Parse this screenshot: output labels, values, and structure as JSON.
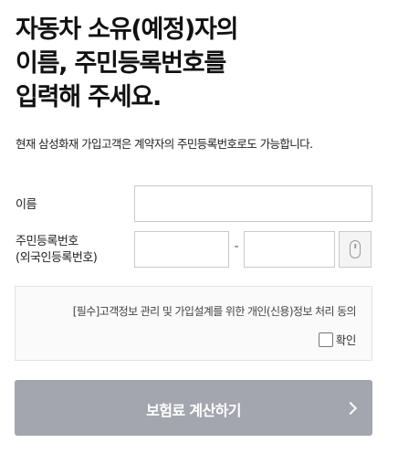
{
  "header": {
    "title_lines": [
      "자동차 소유(예정)자의",
      "이름, 주민등록번호를",
      "입력해 주세요."
    ],
    "subtitle": "현재 삼성화재 가입고객은 계약자의 주민등록번호로도 가능합니다."
  },
  "form": {
    "name_label": "이름",
    "name_value": "",
    "rrn_label_lines": [
      "주민등록번호",
      "(외국인등록번호)"
    ],
    "rrn_front_value": "",
    "rrn_separator": "-",
    "rrn_back_value": "",
    "keypad_icon": "mouse-icon"
  },
  "agreement": {
    "text": "[필수]고객정보 관리 및 가입설계를 위한 개인(신용)정보 처리 동의",
    "confirm_label": "확인",
    "checked": false
  },
  "submit": {
    "label": "보험료 계산하기",
    "icon": "chevron-right-icon",
    "bg_color": "#a3a6ae"
  }
}
